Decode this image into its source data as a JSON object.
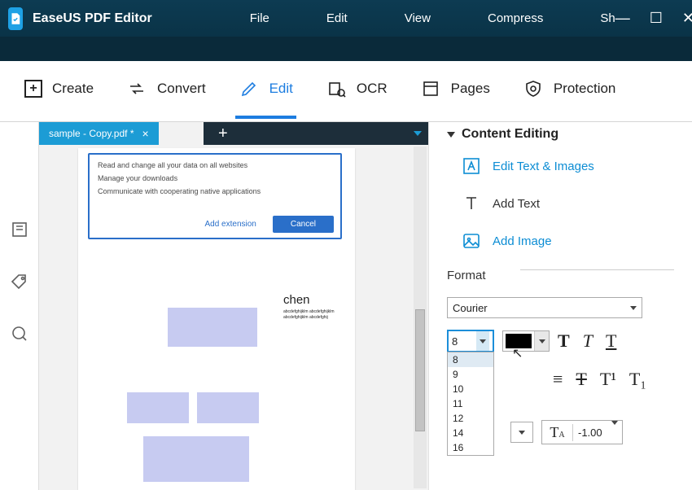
{
  "app": {
    "title": "EaseUS PDF Editor"
  },
  "menu": {
    "file": "File",
    "edit": "Edit",
    "view": "View",
    "compress": "Compress",
    "share": "Sh"
  },
  "toolbar": {
    "create": "Create",
    "convert": "Convert",
    "edit": "Edit",
    "ocr": "OCR",
    "pages": "Pages",
    "protection": "Protection",
    "active": "edit"
  },
  "tab": {
    "name": "sample - Copy.pdf *"
  },
  "page": {
    "popup": {
      "line1": "Read and change all your data on all websites",
      "line2": "Manage your downloads",
      "line3": "Communicate with cooperating native applications",
      "add": "Add extension",
      "cancel": "Cancel"
    },
    "word": "chen",
    "tiny": "abcdefghijklm\nabcdefghijklm\nabcdefghijklm\nabcdefghij"
  },
  "panel": {
    "title": "Content Editing",
    "edit_text_images": "Edit Text & Images",
    "add_text": "Add Text",
    "add_image": "Add Image",
    "format_label": "Format",
    "font": "Courier",
    "size": "8",
    "size_options": [
      "8",
      "9",
      "10",
      "11",
      "12",
      "14",
      "16"
    ],
    "spacing": "-1.00",
    "color": "#000000"
  }
}
